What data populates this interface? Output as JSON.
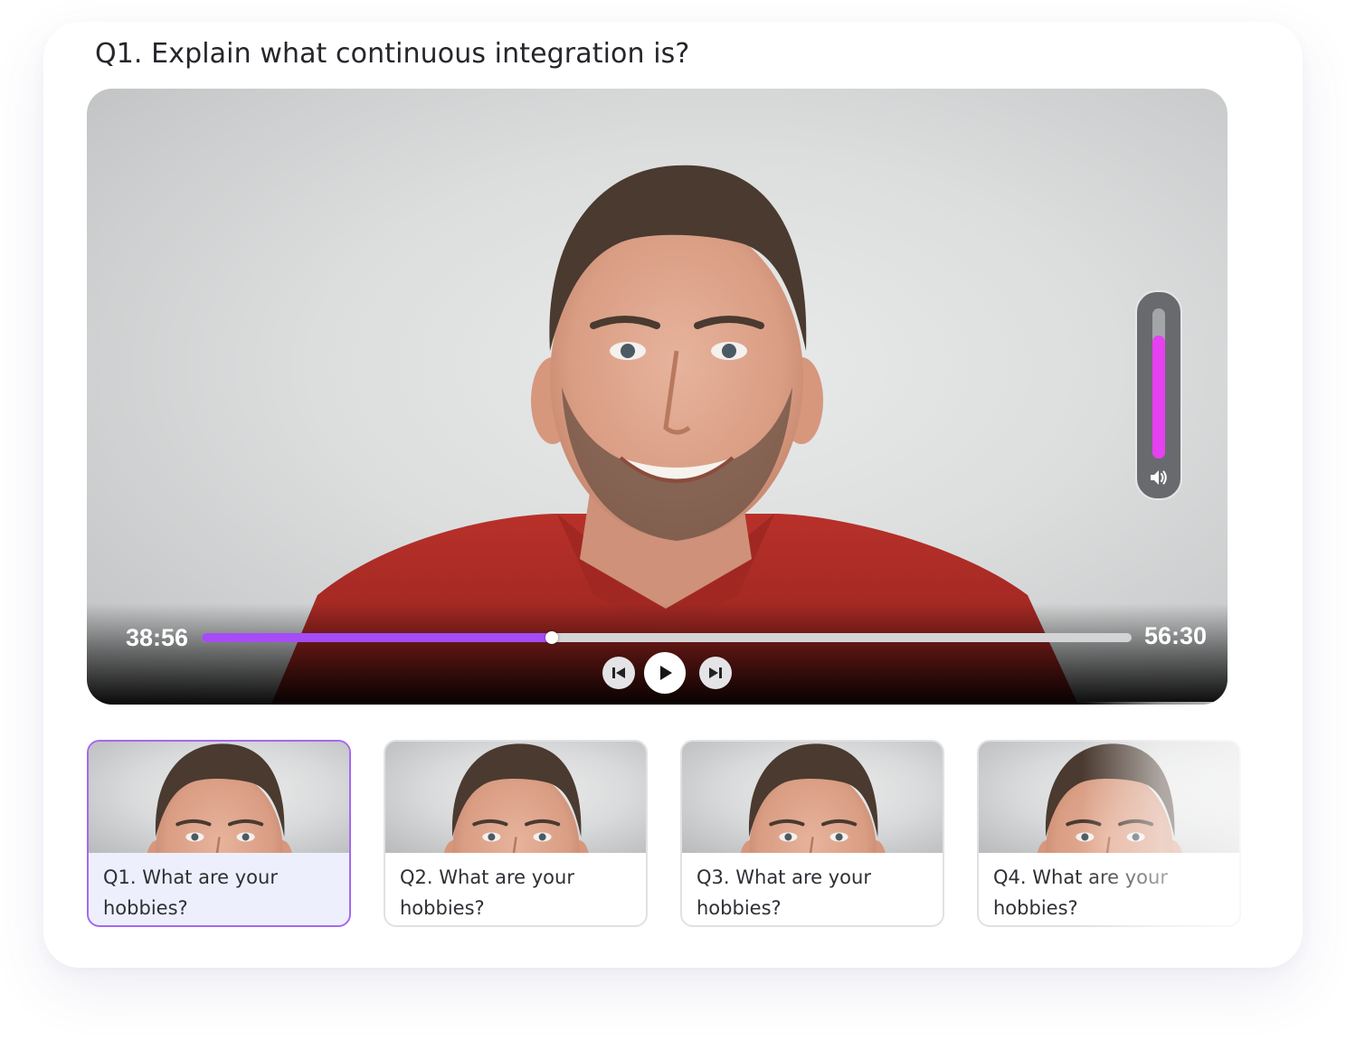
{
  "question": {
    "title": "Q1. Explain what continuous integration is?"
  },
  "player": {
    "current_time": "38:56",
    "total_time": "56:30",
    "progress_fraction": 0.376,
    "volume_fraction": 0.82,
    "accent_color": "#a54cf5",
    "volume_color": "#e640f0",
    "controls": {
      "previous_icon": "skip-previous-icon",
      "play_icon": "play-icon",
      "next_icon": "skip-next-icon",
      "volume_icon": "volume-icon"
    }
  },
  "thumbnails": [
    {
      "label": "Q1. What are your hobbies?",
      "active": true
    },
    {
      "label": "Q2. What are your hobbies?",
      "active": false
    },
    {
      "label": "Q3. What are your hobbies?",
      "active": false
    },
    {
      "label": "Q4. What are your hobbies?",
      "active": false
    }
  ]
}
